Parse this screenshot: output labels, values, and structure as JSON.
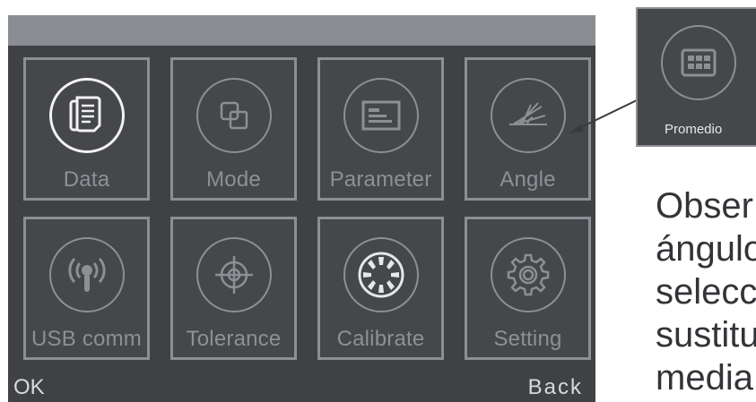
{
  "menu": {
    "tiles": [
      {
        "label": "Data",
        "icon": "document-stack-icon",
        "active": true
      },
      {
        "label": "Mode",
        "icon": "overlapping-squares-icon"
      },
      {
        "label": "Parameter",
        "icon": "screen-panel-icon"
      },
      {
        "label": "Angle",
        "icon": "angle-rays-icon"
      },
      {
        "label": "USB comm",
        "icon": "usb-antenna-icon"
      },
      {
        "label": "Tolerance",
        "icon": "crosshair-icon"
      },
      {
        "label": "Calibrate",
        "icon": "calibration-dial-icon"
      },
      {
        "label": "Setting",
        "icon": "gear-icon"
      }
    ]
  },
  "bottombar": {
    "ok_label": "OK",
    "back_label": "Back"
  },
  "callout": {
    "label": "Promedio",
    "icon": "grid-display-icon"
  },
  "caption": {
    "lines": [
      "Obser",
      "ángulo",
      "selecc",
      "sustitu",
      "media"
    ]
  },
  "colors": {
    "screen_bg": "#3f4145",
    "topbar": "#8a8d92",
    "tile_border": "#8c8f93",
    "active_icon": "#f2f2f2",
    "label": "#8d9095"
  }
}
